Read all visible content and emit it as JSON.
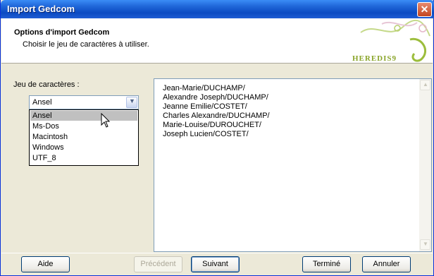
{
  "window": {
    "title": "Import Gedcom",
    "close_icon": "close-icon"
  },
  "header": {
    "title": "Options d'import Gedcom",
    "subtitle": "Choisir le jeu de caractères à utiliser.",
    "logo_text": "HEREDIS9"
  },
  "charset": {
    "label": "Jeu de caractères :",
    "selected": "Ansel",
    "options": [
      "Ansel",
      "Ms-Dos",
      "Macintosh",
      "Windows",
      "UTF_8"
    ],
    "highlighted_option": "Ansel"
  },
  "preview": {
    "lines": [
      "Jean-Marie/DUCHAMP/",
      "Alexandre Joseph/DUCHAMP/",
      "Jeanne Emilie/COSTET/",
      "Charles Alexandre/DUCHAMP/",
      "Marie-Louise/DUROUCHET/",
      "Joseph Lucien/COSTET/"
    ]
  },
  "buttons": {
    "aide": "Aide",
    "precedent": "Précédent",
    "suivant": "Suivant",
    "termine": "Terminé",
    "annuler": "Annuler"
  },
  "colors": {
    "title_bar": "#0b4ac2",
    "logo_green": "#8aa52a",
    "selection_gray": "#c0c0c0"
  }
}
